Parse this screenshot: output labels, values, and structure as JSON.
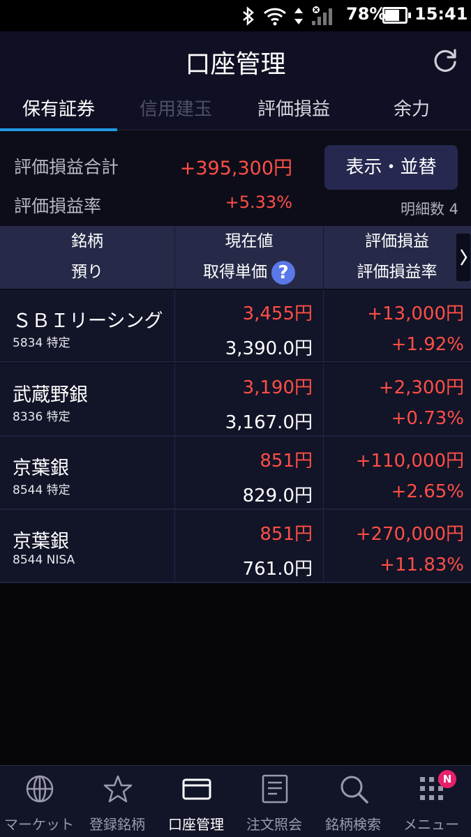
{
  "status_bar": {
    "battery": "78%",
    "time": "15:41"
  },
  "header": {
    "title": "口座管理"
  },
  "tabs": [
    {
      "label": "保有証券",
      "state": "active"
    },
    {
      "label": "信用建玉",
      "state": "disabled"
    },
    {
      "label": "評価損益",
      "state": "normal"
    },
    {
      "label": "余力",
      "state": "normal"
    }
  ],
  "summary": {
    "total_label": "評価損益合計",
    "total_value": "+395,300円",
    "rate_label": "評価損益率",
    "rate_value": "+5.33%",
    "sort_button": "表示・並替",
    "count": "明細数 4"
  },
  "table_header": {
    "col1_top": "銘柄",
    "col1_bottom": "預り",
    "col2_top": "現在値",
    "col2_bottom": "取得単価",
    "col3_top": "評価損益",
    "col3_bottom": "評価損益率",
    "help": "?"
  },
  "holdings": [
    {
      "name": "ＳＢＩリーシング",
      "code": "5834 特定",
      "price": "3,455円",
      "cost": "3,390.0円",
      "pl": "+13,000円",
      "pl_rate": "+1.92%"
    },
    {
      "name": "武蔵野銀",
      "code": "8336 特定",
      "price": "3,190円",
      "cost": "3,167.0円",
      "pl": "+2,300円",
      "pl_rate": "+0.73%"
    },
    {
      "name": "京葉銀",
      "code": "8544 特定",
      "price": "851円",
      "cost": "829.0円",
      "pl": "+110,000円",
      "pl_rate": "+2.65%"
    },
    {
      "name": "京葉銀",
      "code": "8544 NISA",
      "price": "851円",
      "cost": "761.0円",
      "pl": "+270,000円",
      "pl_rate": "+11.83%"
    }
  ],
  "bottom_nav": [
    {
      "label": "マーケット",
      "icon": "globe-icon"
    },
    {
      "label": "登録銘柄",
      "icon": "star-icon"
    },
    {
      "label": "口座管理",
      "icon": "card-icon",
      "active": true
    },
    {
      "label": "注文照会",
      "icon": "document-icon"
    },
    {
      "label": "銘柄検索",
      "icon": "search-icon"
    },
    {
      "label": "メニュー",
      "icon": "grid-icon"
    }
  ],
  "menu_badge": "N",
  "colors": {
    "positive": "#ff4f45",
    "accent": "#1e9be6",
    "header_bg": "#101024",
    "row_bg": "#121428"
  }
}
